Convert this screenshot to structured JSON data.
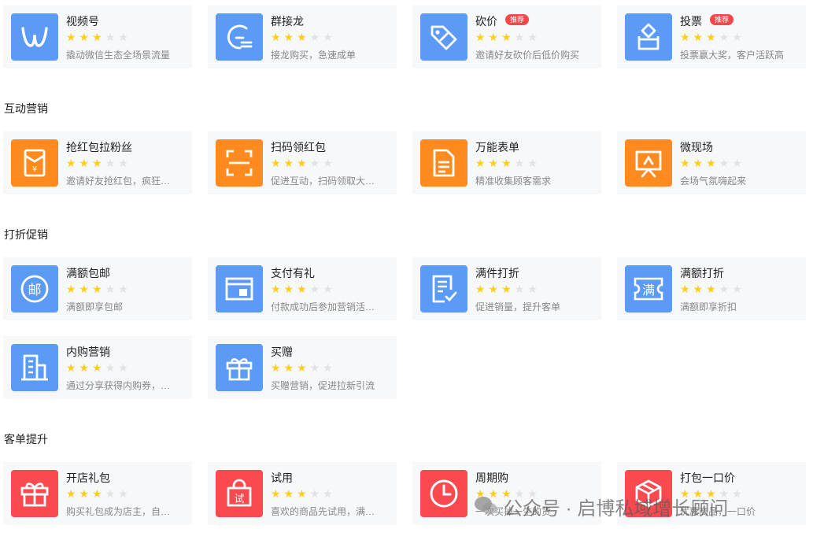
{
  "sections": [
    {
      "title": ""
    },
    {
      "title": "互动营销"
    },
    {
      "title": "打折促销"
    },
    {
      "title": "客单提升"
    }
  ],
  "cards": [
    {
      "name": "视频号",
      "desc": "撬动微信生态全场景流量",
      "rating": 3,
      "icon": "video-channel-icon",
      "color": "#5b9bf6",
      "badge": ""
    },
    {
      "name": "群接龙",
      "desc": "接龙购买，急速成单",
      "rating": 3,
      "icon": "group-relay-icon",
      "color": "#5b9bf6",
      "badge": ""
    },
    {
      "name": "砍价",
      "desc": "邀请好友砍价后低价购买",
      "rating": 3,
      "icon": "price-tag-icon",
      "color": "#5b9bf6",
      "badge": "推荐"
    },
    {
      "name": "投票",
      "desc": "投票赢大奖，客户活跃高",
      "rating": 3,
      "icon": "ballot-box-icon",
      "color": "#5b9bf6",
      "badge": "推荐"
    },
    {
      "name": "抢红包拉粉丝",
      "desc": "邀请好友抢红包，疯狂…",
      "rating": 3,
      "icon": "red-envelope-icon",
      "color": "#ff8a1f",
      "badge": ""
    },
    {
      "name": "扫码领红包",
      "desc": "促进互动，扫码领取大…",
      "rating": 3,
      "icon": "scan-code-icon",
      "color": "#ff8a1f",
      "badge": ""
    },
    {
      "name": "万能表单",
      "desc": "精准收集顾客需求",
      "rating": 3,
      "icon": "form-document-icon",
      "color": "#ff8a1f",
      "badge": ""
    },
    {
      "name": "微现场",
      "desc": "会场气氛嗨起来",
      "rating": 3,
      "icon": "presentation-board-icon",
      "color": "#ff8a1f",
      "badge": ""
    },
    {
      "name": "满额包邮",
      "desc": "满额即享包邮",
      "rating": 3,
      "icon": "postal-icon",
      "color": "#5b9bf6",
      "badge": ""
    },
    {
      "name": "支付有礼",
      "desc": "付款成功后参加营销活…",
      "rating": 3,
      "icon": "payment-gift-icon",
      "color": "#5b9bf6",
      "badge": ""
    },
    {
      "name": "满件打折",
      "desc": "促进销量，提升客单",
      "rating": 3,
      "icon": "checklist-icon",
      "color": "#5b9bf6",
      "badge": ""
    },
    {
      "name": "满额打折",
      "desc": "满额即享折扣",
      "rating": 3,
      "icon": "full-discount-ticket-icon",
      "color": "#5b9bf6",
      "badge": ""
    },
    {
      "name": "内购营销",
      "desc": "通过分享获得内购券，…",
      "rating": 3,
      "icon": "building-icon",
      "color": "#5b9bf6",
      "badge": ""
    },
    {
      "name": "买赠",
      "desc": "买赠营销，促进拉新引流",
      "rating": 3,
      "icon": "gift-box-icon",
      "color": "#5b9bf6",
      "badge": ""
    },
    {
      "name": "开店礼包",
      "desc": "购买礼包成为店主，自…",
      "rating": 3,
      "icon": "gift-icon",
      "color": "#fa4a4f",
      "badge": ""
    },
    {
      "name": "试用",
      "desc": "喜欢的商品先试用，满…",
      "rating": 3,
      "icon": "trial-bag-icon",
      "color": "#fa4a4f",
      "badge": ""
    },
    {
      "name": "周期购",
      "desc": "一次买掉一生的货",
      "rating": 3,
      "icon": "clock-icon",
      "color": "#fa4a4f",
      "badge": ""
    },
    {
      "name": "打包一口价",
      "desc": "优惠商品，一口价",
      "rating": 3,
      "icon": "package-box-icon",
      "color": "#fa4a4f",
      "badge": ""
    }
  ],
  "watermark": {
    "text": "公众号 · 启博私域增长顾问",
    "icon": "wechat-logo-icon"
  }
}
